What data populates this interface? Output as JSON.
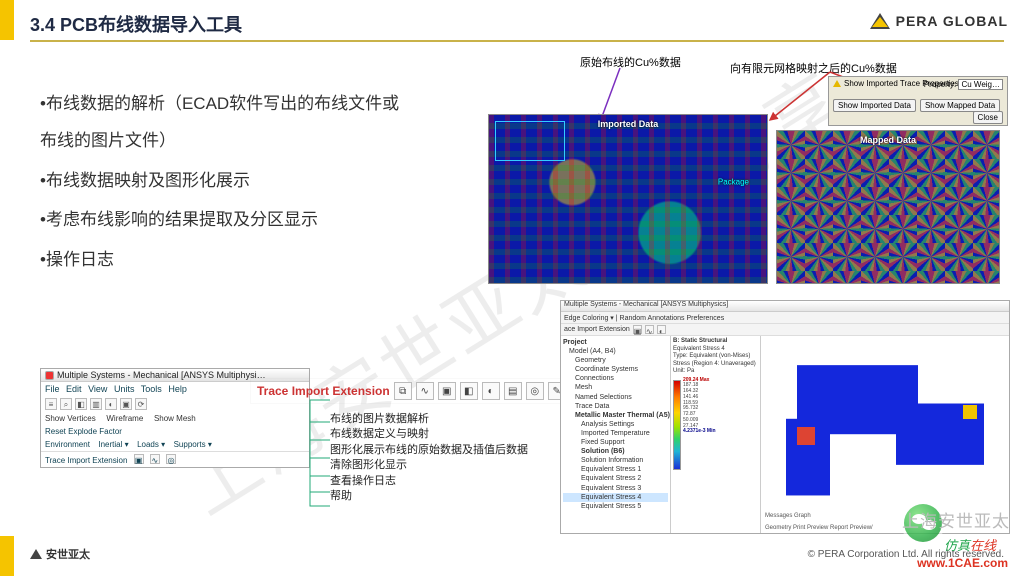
{
  "brand": {
    "name": "PERA GLOBAL"
  },
  "title": "3.4 PCB布线数据导入工具",
  "bullets": {
    "b1": "•布线数据的解析（ECAD软件写出的布线文件或布线的图片文件）",
    "b2": "•布线数据映射及图形化展示",
    "b3": "•考虑布线影响的结果提取及分区显示",
    "b4": "•操作日志"
  },
  "callouts": {
    "raw_cu": "原始布线的Cu%数据",
    "mapped_cu": "向有限元网格映射之后的Cu%数据"
  },
  "import_panel": {
    "title": "Show Imported Trace Properties",
    "prop_label": "Property:",
    "prop_value": "Cu Weig…",
    "btn_imported": "Show Imported Data",
    "btn_mapped": "Show Mapped Data",
    "btn_close": "Close"
  },
  "canvas_labels": {
    "imported": "Imported Data",
    "mapped": "Mapped Data",
    "pkg": "Package"
  },
  "toolbar_window": {
    "title": "Multiple Systems - Mechanical [ANSYS Multiphysi…",
    "menu": {
      "file": "File",
      "edit": "Edit",
      "view": "View",
      "units": "Units",
      "tools": "Tools",
      "help": "Help"
    },
    "row_show": "Show Vertices",
    "row_wire": "Wireframe",
    "row_mesh": "Show Mesh",
    "row_reset": "Reset Explode Factor",
    "row_env": "Environment",
    "row_inertial": "Inertial ▾",
    "row_loads": "Loads ▾",
    "row_supports": "Supports ▾",
    "ext_row": "Trace Import Extension"
  },
  "extension": {
    "label": "Trace Import Extension",
    "icons": [
      "⧉",
      "∿",
      "▣",
      "◧",
      "◐",
      "▤",
      "◎",
      "✎"
    ]
  },
  "ext_desc": {
    "l1": "布线的图片数据解析",
    "l2": "布线数据定义与映射",
    "l3": "图形化展示布线的原始数据及插值后数据",
    "l4": "清除图形化显示",
    "l5": "查看操作日志",
    "l6": "帮助"
  },
  "big_app": {
    "title": "Multiple Systems - Mechanical [ANSYS Multiphysics]",
    "tabs_row": "Edge Coloring ▾  | Random Annotations  Preferences",
    "ext_row": "ace Import Extension",
    "tree": {
      "root": "Project",
      "n1": "Model (A4, B4)",
      "n2": "Geometry",
      "n3": "Coordinate Systems",
      "n4": "Connections",
      "n5": "Mesh",
      "n6": "Named Selections",
      "n7": "Trace Data",
      "n8": "Metallic Master Thermal (A5)",
      "n9": "Analysis Settings",
      "n10": "Imported Temperature",
      "n11": "Fixed Support",
      "n12": "Solution (B6)",
      "n13": "Solution Information",
      "n14": "Equivalent Stress 1",
      "n15": "Equivalent Stress 2",
      "n16": "Equivalent Stress 3",
      "n17": "Equivalent Stress 4",
      "n18": "Equivalent Stress 5"
    },
    "result_title": "B: Static Structural",
    "result_sub": "Equivalent Stress 4",
    "result_type": "Type: Equivalent (von-Mises) Stress (Region 4: Unaveraged)",
    "result_unit": "Unit: Pa",
    "legend_max": "209.24 Max",
    "legend_vals": [
      "187.18",
      "164.32",
      "141.46",
      "118.59",
      "95.732",
      "72.87",
      "50.009",
      "27.147"
    ],
    "legend_min": "4.2371e-3 Min",
    "status": "Geometry  Print Preview  Report Preview/",
    "bottom": "Messages   Graph"
  },
  "footer": {
    "left": "安世亚太",
    "right": "© PERA Corporation Ltd. All rights reserved."
  },
  "watermark": {
    "diag": "上海安世亚太资料分享",
    "gray": "上海安世亚太",
    "sim_a": "仿真",
    "sim_b": "在线",
    "url": "www.1CAE.com"
  }
}
